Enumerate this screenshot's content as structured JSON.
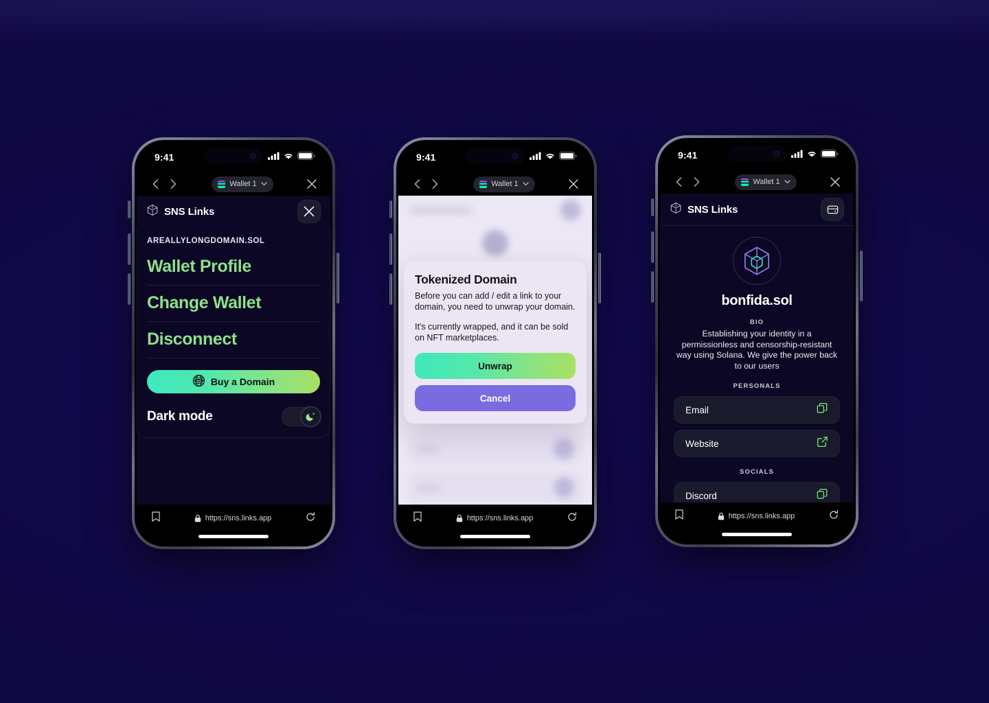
{
  "theme": {
    "page_bg": "#140a52",
    "accent_green": "#8ee08a",
    "gradient_start": "#3fe8c0",
    "gradient_end": "#a8e063",
    "purple": "#7b6be0",
    "app_dark_bg": "#0b0724",
    "modal_bg": "#ece5f3"
  },
  "status_bar": {
    "time": "9:41"
  },
  "browser": {
    "wallet_label": "Wallet 1",
    "url": "https://sns.links.app",
    "back_icon": "chevron-left-icon",
    "forward_icon": "chevron-right-icon",
    "close_icon": "close-icon",
    "bookmark_icon": "bookmark-icon",
    "reload_icon": "reload-icon",
    "lock_icon": "lock-icon"
  },
  "phone1": {
    "app_name": "SNS Links",
    "close_label": "close-panel",
    "domain": "AREALLYLONGDOMAIN.SOL",
    "menu": [
      {
        "label": "Wallet Profile"
      },
      {
        "label": "Change Wallet"
      },
      {
        "label": "Disconnect"
      }
    ],
    "buy_button": "Buy a Domain",
    "buy_icon": "sns-globe-icon",
    "dark_mode_label": "Dark mode",
    "dark_mode_on": true,
    "toggle_icon": "moon-icon"
  },
  "phone2": {
    "modal": {
      "title": "Tokenized Domain",
      "paragraph1": "Before you can add / edit a link to your domain, you need to unwrap your domain.",
      "paragraph2": "It's currently wrapped, and it can be sold on NFT marketplaces.",
      "primary_button": "Unwrap",
      "secondary_button": "Cancel"
    }
  },
  "phone3": {
    "app_name": "SNS Links",
    "wallet_icon": "wallet-icon",
    "avatar_icon": "sns-cube-icon",
    "domain_name": "bonfida.sol",
    "bio_label": "BIO",
    "bio_text": "Establishing your identity in a permissionless and censorship-resistant way using Solana. We give the power back to our users",
    "sections": [
      {
        "label": "PERSONALS",
        "items": [
          {
            "label": "Email",
            "action_icon": "copy-icon"
          },
          {
            "label": "Website",
            "action_icon": "external-link-icon"
          }
        ]
      },
      {
        "label": "SOCIALS",
        "items": [
          {
            "label": "Discord",
            "action_icon": "copy-icon"
          }
        ]
      }
    ]
  }
}
